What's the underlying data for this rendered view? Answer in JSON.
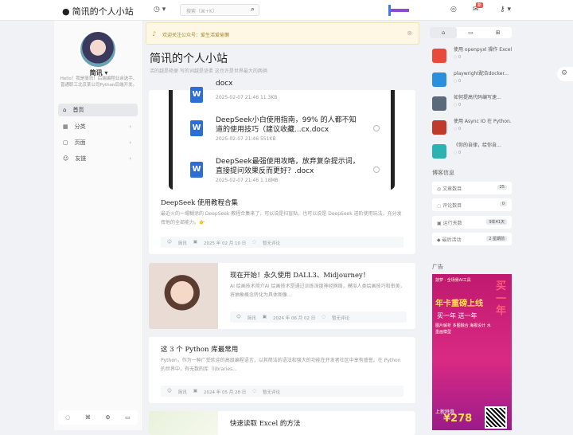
{
  "header": {
    "site_name": "简讯的个人小站",
    "search_placeholder": "搜索（⌘+K）",
    "notif_badge": "新"
  },
  "sidebar": {
    "username": "简讯",
    "bio": "Hello！我是简讯！后端编程业余选手、普通职工北京某公司Python后端开发。",
    "items": [
      {
        "label": "首页"
      },
      {
        "label": "分类"
      },
      {
        "label": "页面"
      },
      {
        "label": "友链"
      }
    ]
  },
  "notice": {
    "text": "欢迎关注公众号：爱生活爱偷懒"
  },
  "page": {
    "title": "简讯的个人小站",
    "subtitle": "活的越是艳便 写的词越是坚柔 这也许是世界最大的两俩"
  },
  "file_list": [
    {
      "name": "docx",
      "meta": "2025-02-07 21:46  11.3KB"
    },
    {
      "name": "DeepSeek小白使用指南，99% 的人都不知道的使用技巧（建议收藏...cx.docx",
      "meta": "2025-02-07 21:46  551KB"
    },
    {
      "name": "DeepSeek最强使用攻略，放弃复杂提示词，直接提问效果反而更好？.docx",
      "meta": "2025-02-07 21:46  1.18MB"
    }
  ],
  "posts": [
    {
      "title": "DeepSeek 使用教程合集",
      "excerpt": "最近火的一塌糊涂的 DeepSeek 教程合集来了，可以说是扫盲贴，也可以说是 DeepSeek 进阶使用玩法，充分发挥他的全部能力。👉",
      "author": "简讯",
      "date": "2025 年 02 月 10 日",
      "comments": "暂无评论"
    },
    {
      "title": "现在开始！永久使用 DALL3、Midjourney！",
      "excerpt": "AI 绘画技术简介AI 绘画技术是通过训练深度神经网络，模拟人类绘画技巧和审美，将抽象概念转化为具体图像...",
      "author": "简讯",
      "date": "2024 年 06 月 02 日",
      "comments": "暂无评论"
    },
    {
      "title": "这 3 个 Python 库最常用",
      "excerpt": "Python，作为一种广受欢迎的高级编程语言，以其简洁的语法和强大的功能在开发者社区中享有盛誉。在 Python 的世界中，有无数的库（libraries...",
      "author": "简讯",
      "date": "2024 年 05 月 28 日",
      "comments": "暂无评论"
    },
    {
      "title": "快速读取 Excel 的方法"
    }
  ],
  "recent": [
    {
      "title": "使用 openpyxl 操作 Excel",
      "comments": "0",
      "color": "#e64b3c"
    },
    {
      "title": "playwright配合docker...",
      "comments": "0",
      "color": "#2b8fe0"
    },
    {
      "title": "如何提高代码编写速...",
      "comments": "0",
      "color": "#5a6a7a"
    },
    {
      "title": "使用 Async IO 在 Python...",
      "comments": "0",
      "color": "#c0392b"
    },
    {
      "title": "《你的自律，给你自...",
      "comments": "0",
      "color": "#2bb3b1"
    }
  ],
  "stats_title": "博客信息",
  "stats": [
    {
      "label": "文章数目",
      "value": "25"
    },
    {
      "label": "评论数目",
      "value": "0"
    },
    {
      "label": "运行天数",
      "value": "9年41天"
    },
    {
      "label": "最后活动",
      "value": "2 星期前"
    }
  ],
  "ad_title": "广告",
  "ad": {
    "brand": "菠萝 · 全场景AI工具",
    "headline": "年卡重磅上线",
    "sub": "买一年 送一年",
    "tags": "图片解析 多图融合 海报设计 水墨画模型",
    "price_label": "上新特惠",
    "price": "¥278",
    "side": "买一年"
  }
}
